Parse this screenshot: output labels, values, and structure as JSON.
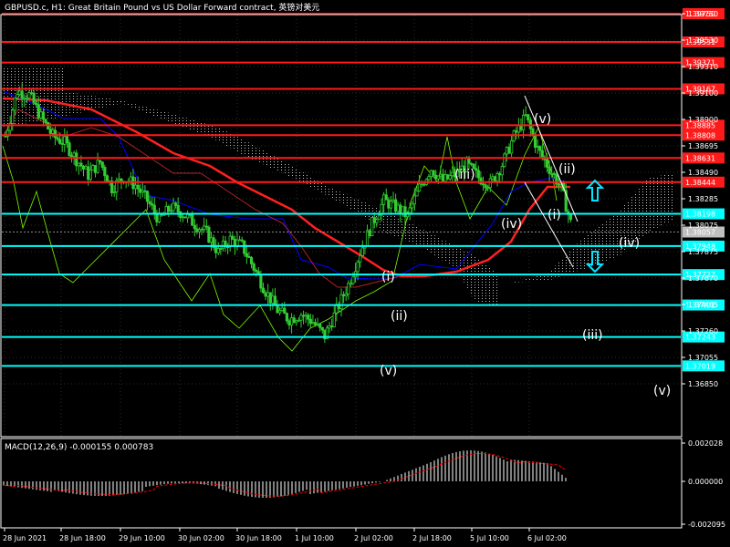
{
  "window": {
    "title": "GBPUSD.c, H1:  Great Britain Pound vs US Dollar Forward contract, 英镑对美元"
  },
  "colors": {
    "background": "#000000",
    "grid": "#2b2b2b",
    "axis": "#ffffff",
    "candle": "#32cd32",
    "resistance": "#ff1a1a",
    "support": "#00ffff",
    "ma_red": "#ff2020",
    "ma_blue": "#0000ff",
    "chikou": "#7cfc00",
    "cloud": "#ffffff",
    "wave_label": "#ffffff",
    "arrow": "#00e5ff",
    "macd_hist": "#ffffff",
    "macd_signal": "#ff0000"
  },
  "price_axis": {
    "labels": [
      "1.39750",
      "1.39530",
      "1.39310",
      "1.39100",
      "1.38900",
      "1.38695",
      "1.38490",
      "1.38285",
      "1.38075",
      "1.37875",
      "1.37670",
      "1.37465",
      "1.37260",
      "1.37055",
      "1.36850"
    ],
    "current_price": "1.38057"
  },
  "resistance_levels": [
    "1.39750",
    "1.39531",
    "1.39371",
    "1.39167",
    "1.38885",
    "1.38808",
    "1.38631",
    "1.38444"
  ],
  "support_levels": [
    "1.38198",
    "1.37948",
    "1.37727",
    "1.37491",
    "1.37243",
    "1.37019"
  ],
  "time_axis": [
    "28 Jun 2021",
    "28 Jun 18:00",
    "29 Jun 10:00",
    "30 Jun 02:00",
    "30 Jun 18:00",
    "1 Jul 10:00",
    "2 Jul 02:00",
    "2 Jul 18:00",
    "5 Jul 10:00",
    "6 Jul 02:00"
  ],
  "wave_labels": [
    "(v)",
    "(ii)",
    "(iii)",
    "(iv)",
    "(i)",
    "(iv)",
    "(i)",
    "(ii)",
    "(v)",
    "(iii)",
    "(v)"
  ],
  "macd": {
    "label": "MACD(12,26,9) -0.000155 0.000783",
    "axis_labels": [
      "0.002028",
      "0.000000",
      "-0.002095"
    ]
  },
  "chart_data": {
    "type": "candlestick",
    "title": "GBPUSD.c, H1:  Great Britain Pound vs US Dollar Forward contract, 英镑对美元",
    "xlabel": "",
    "ylabel": "",
    "ylim": [
      1.3672,
      1.3988
    ],
    "x": [
      "28 Jun 2021",
      "28 Jun 18:00",
      "29 Jun 10:00",
      "30 Jun 02:00",
      "30 Jun 18:00",
      "1 Jul 10:00",
      "2 Jul 02:00",
      "2 Jul 18:00",
      "5 Jul 10:00",
      "6 Jul 02:00"
    ],
    "price_path": [
      1.388,
      1.3915,
      1.3912,
      1.3895,
      1.388,
      1.3875,
      1.3862,
      1.385,
      1.386,
      1.384,
      1.3848,
      1.3842,
      1.383,
      1.3815,
      1.3825,
      1.382,
      1.3812,
      1.3805,
      1.379,
      1.38,
      1.3795,
      1.3778,
      1.376,
      1.3745,
      1.3738,
      1.3742,
      1.3736,
      1.3725,
      1.3745,
      1.3765,
      1.379,
      1.3812,
      1.383,
      1.3825,
      1.3818,
      1.384,
      1.3855,
      1.3845,
      1.385,
      1.3858,
      1.3848,
      1.3843,
      1.3858,
      1.388,
      1.3895,
      1.387,
      1.3855,
      1.384,
      1.3806
    ],
    "series": [
      {
        "name": "",
        "values": [
          1.3865,
          1.3882,
          1.3875,
          1.3852,
          1.384,
          1.3835,
          1.3825,
          1.381,
          1.3805,
          1.38,
          1.3798,
          1.38,
          1.3808,
          1.3822,
          1.3835,
          1.3855
        ]
      },
      {
        "name": "",
        "values": [
          1.388,
          1.3888,
          1.388,
          1.386,
          1.3838,
          1.382,
          1.3818,
          1.3805,
          1.3788,
          1.379,
          1.3794,
          1.38,
          1.383,
          1.385,
          1.3858
        ]
      }
    ],
    "resistance_levels": [
      1.3975,
      1.39531,
      1.39371,
      1.39167,
      1.38885,
      1.38808,
      1.38631,
      1.38444
    ],
    "support_levels": [
      1.38198,
      1.37948,
      1.37727,
      1.37491,
      1.37243,
      1.37019
    ],
    "current_price": 1.38057,
    "grid": true,
    "legend": "none"
  }
}
